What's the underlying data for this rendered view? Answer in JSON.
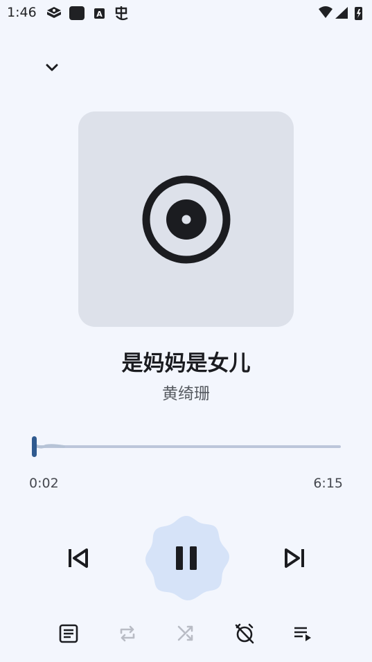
{
  "status_bar": {
    "time": "1:46"
  },
  "player": {
    "song_title": "是妈妈是女儿",
    "artist": "黄绮珊",
    "elapsed": "0:02",
    "duration": "6:15",
    "progress_fraction": 0.005,
    "state": "playing"
  },
  "colors": {
    "background": "#f3f6fd",
    "album_placeholder": "#dde1ea",
    "accent": "#2f5a8f",
    "play_button_bg": "#d6e3f8",
    "track": "#bcc6da"
  },
  "icons": {
    "collapse": "chevron-down-icon",
    "album_placeholder": "disc-icon",
    "previous": "skip-previous-icon",
    "play_pause": "pause-icon",
    "next": "skip-next-icon",
    "lyrics": "lyrics-icon",
    "repeat": "repeat-icon",
    "shuffle": "shuffle-icon",
    "sleep_timer": "alarm-off-icon",
    "queue": "queue-icon"
  }
}
